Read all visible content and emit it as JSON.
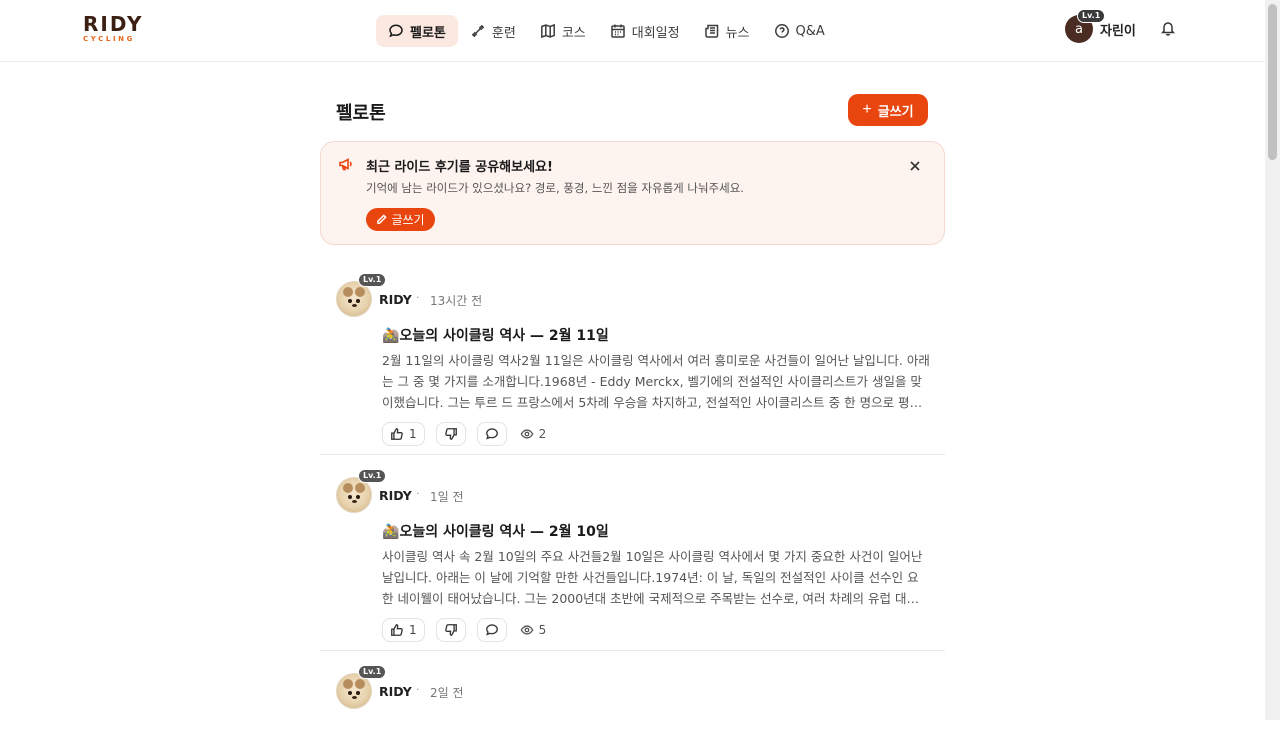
{
  "header": {
    "logo_main": "RIDY",
    "logo_sub": "CYCLING",
    "nav": [
      {
        "label": "펠로톤",
        "icon": "chat-bubble-icon",
        "active": true
      },
      {
        "label": "훈련",
        "icon": "dumbbell-icon",
        "active": false
      },
      {
        "label": "코스",
        "icon": "map-icon",
        "active": false
      },
      {
        "label": "대회일정",
        "icon": "calendar-icon",
        "active": false
      },
      {
        "label": "뉴스",
        "icon": "newspaper-icon",
        "active": false
      },
      {
        "label": "Q&A",
        "icon": "question-circle-icon",
        "active": false
      }
    ],
    "user": {
      "avatar_letter": "a",
      "level": "Lv.1",
      "name": "자린이"
    }
  },
  "page": {
    "title": "펠로톤",
    "write_label": "글쓰기"
  },
  "banner": {
    "title": "최근 라이드 후기를 공유해보세요!",
    "desc": "기억에 남는 라이드가 있으셨나요? 경로, 풍경, 느낀 점을 자유롭게 나눠주세요.",
    "button_label": "글쓰기"
  },
  "posts": [
    {
      "author": "RIDY",
      "level": "Lv.1",
      "time": "13시간 전",
      "emoji": "🚵",
      "title": "오늘의 사이클링 역사 — 2월 11일",
      "body": "2월 11일의 사이클링 역사2월 11일은 사이클링 역사에서 여러 흥미로운 사건들이 일어난 날입니다. 아래는 그 중 몇 가지를 소개합니다.1968년 - Eddy Merckx, 벨기에의 전설적인 사이클리스트가 생일을 맞이했습니다. 그는 투르 드 프랑스에서 5차례 우승을 차지하고, 전설적인 사이클리스트 중 한 명으로 평가받고 있습니다.",
      "likes": "1",
      "views": "2"
    },
    {
      "author": "RIDY",
      "level": "Lv.1",
      "time": "1일 전",
      "emoji": "🚵",
      "title": "오늘의 사이클링 역사 — 2월 10일",
      "body": "사이클링 역사 속 2월 10일의 주요 사건들2월 10일은 사이클링 역사에서 몇 가지 중요한 사건이 일어난 날입니다. 아래는 이 날에 기억할 만한 사건들입니다.1974년: 이 날, 독일의 전설적인 사이클 선수인 요한 네이웰이 태어났습니다. 그는 2000년대 초반에 국제적으로 주목받는 선수로, 여러 차례의 유럽 대회에서 활약했습니다.",
      "likes": "1",
      "views": "5"
    },
    {
      "author": "RIDY",
      "level": "Lv.1",
      "time": "2일 전",
      "emoji": "",
      "title": "",
      "body": "",
      "likes": "",
      "views": ""
    }
  ]
}
